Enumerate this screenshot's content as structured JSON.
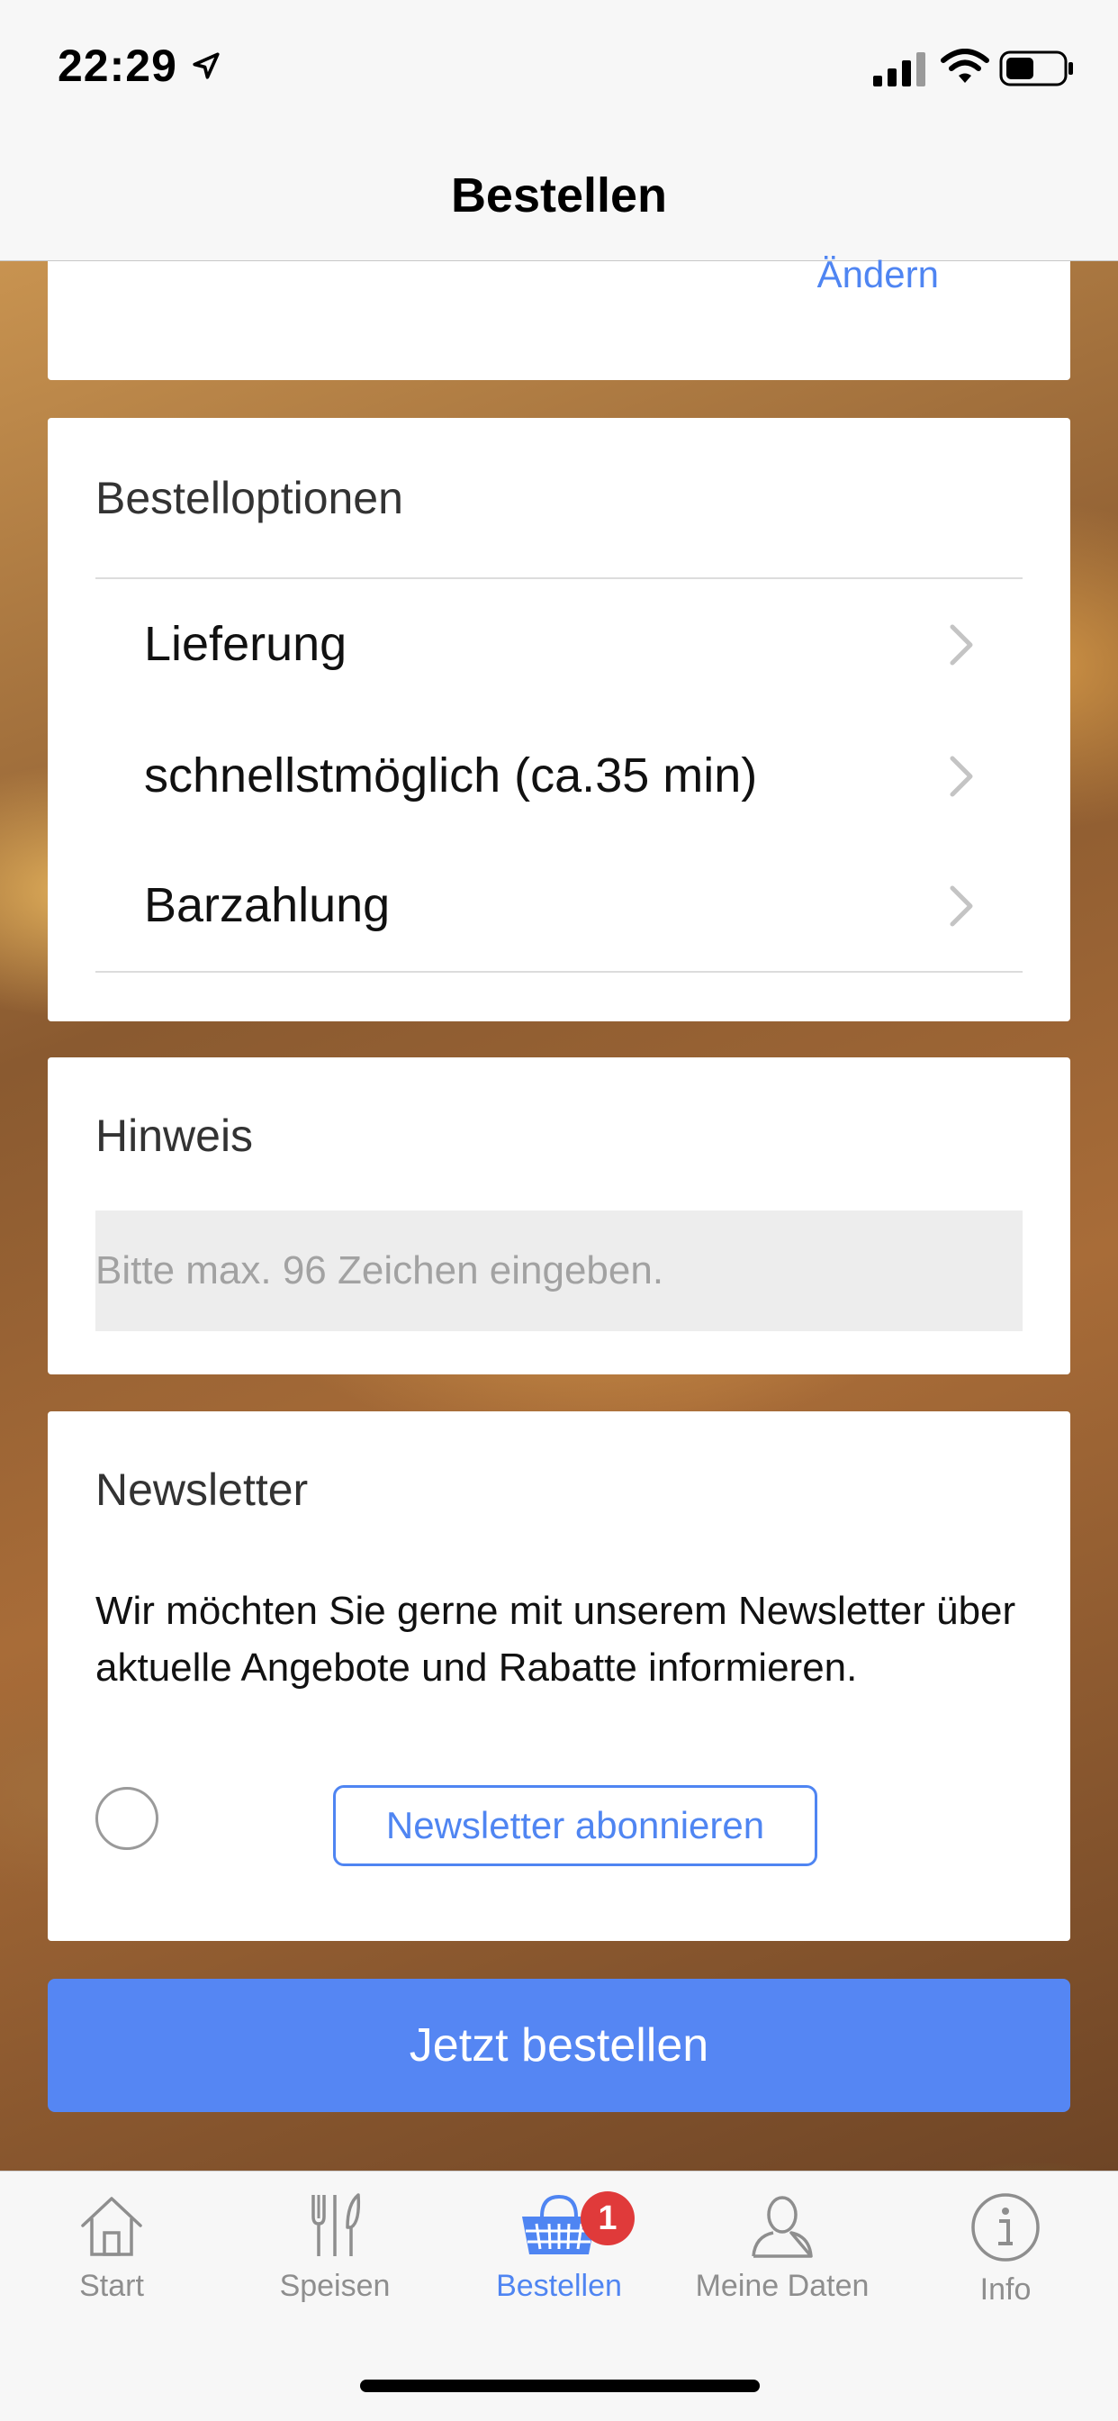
{
  "status_bar": {
    "time": "22:29"
  },
  "nav": {
    "title": "Bestellen"
  },
  "address_card": {
    "change_label": "Ändern"
  },
  "order_options": {
    "title": "Bestelloptionen",
    "items": [
      {
        "label": "Lieferung"
      },
      {
        "label": "schnellstmöglich (ca.35 min)"
      },
      {
        "label": "Barzahlung"
      }
    ]
  },
  "hint": {
    "title": "Hinweis",
    "placeholder": "Bitte max. 96 Zeichen eingeben.",
    "value": ""
  },
  "newsletter": {
    "title": "Newsletter",
    "text": "Wir möchten Sie gerne mit unserem Newsletter über aktuelle Angebote und Rabatte informieren.",
    "checked": false,
    "subscribe_label": "Newsletter abonnieren"
  },
  "order_button": {
    "label": "Jetzt bestellen"
  },
  "tab_bar": {
    "tabs": [
      {
        "label": "Start",
        "icon": "home-icon",
        "active": false
      },
      {
        "label": "Speisen",
        "icon": "fork-knife-icon",
        "active": false
      },
      {
        "label": "Bestellen",
        "icon": "basket-icon",
        "active": true,
        "badge": "1"
      },
      {
        "label": "Meine Daten",
        "icon": "user-icon",
        "active": false
      },
      {
        "label": "Info",
        "icon": "info-icon",
        "active": false
      }
    ]
  },
  "colors": {
    "accent": "#4f85f2",
    "order_button": "#5586f3",
    "badge": "#e03a3a"
  }
}
